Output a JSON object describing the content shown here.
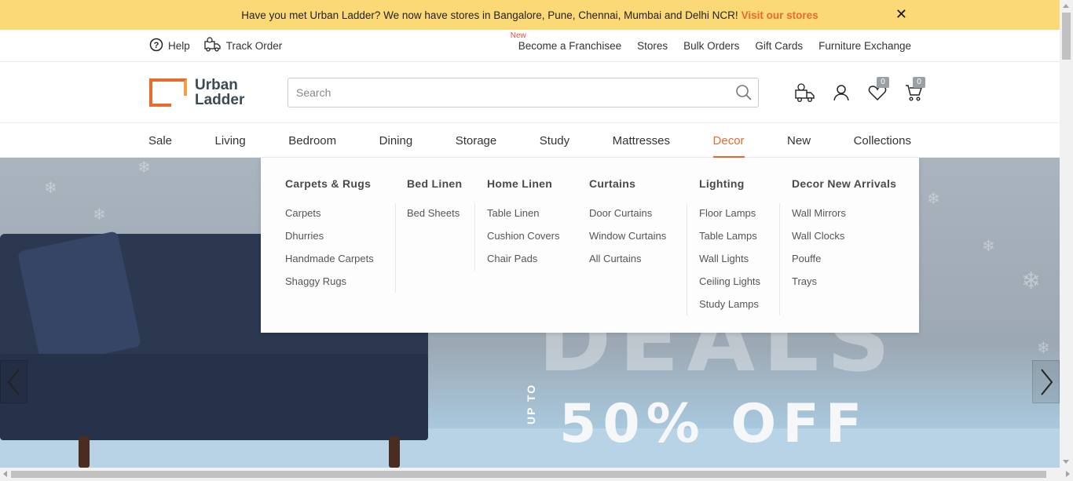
{
  "announcement": {
    "text": "Have you met Urban Ladder? We now have stores in Bangalore, Pune, Chennai, Mumbai and Delhi NCR!",
    "link": "Visit our stores",
    "close": "✕"
  },
  "utility": {
    "help": "Help",
    "track_order": "Track Order",
    "new_tag": "New",
    "links": [
      "Become a Franchisee",
      "Stores",
      "Bulk Orders",
      "Gift Cards",
      "Furniture Exchange"
    ]
  },
  "header": {
    "logo_line1": "Urban",
    "logo_line2": "Ladder",
    "search_placeholder": "Search",
    "wishlist_count": "0",
    "cart_count": "0"
  },
  "nav": {
    "items": [
      "Sale",
      "Living",
      "Bedroom",
      "Dining",
      "Storage",
      "Study",
      "Mattresses",
      "Decor",
      "New",
      "Collections"
    ],
    "active": "Decor"
  },
  "mega_menu": {
    "columns": [
      {
        "title": "Carpets & Rugs",
        "links": [
          "Carpets",
          "Dhurries",
          "Handmade Carpets",
          "Shaggy Rugs"
        ]
      },
      {
        "title": "Bed Linen",
        "links": [
          "Bed Sheets"
        ]
      },
      {
        "title": "Home Linen",
        "links": [
          "Table Linen",
          "Cushion Covers",
          "Chair Pads"
        ]
      },
      {
        "title": "Curtains",
        "links": [
          "Door Curtains",
          "Window Curtains",
          "All Curtains"
        ]
      },
      {
        "title": "Lighting",
        "links": [
          "Floor Lamps",
          "Table Lamps",
          "Wall Lights",
          "Ceiling Lights",
          "Study Lamps"
        ]
      },
      {
        "title": "Decor New Arrivals",
        "links": [
          "Wall Mirrors",
          "Wall Clocks",
          "Pouffe",
          "Trays"
        ]
      }
    ]
  },
  "hero": {
    "headline": "DEALS",
    "upto": "UP TO",
    "offer": "50% OFF"
  },
  "colors": {
    "accent": "#e96a2f",
    "announcement_bg": "#fcd977",
    "badge": "#9aa0a6"
  }
}
